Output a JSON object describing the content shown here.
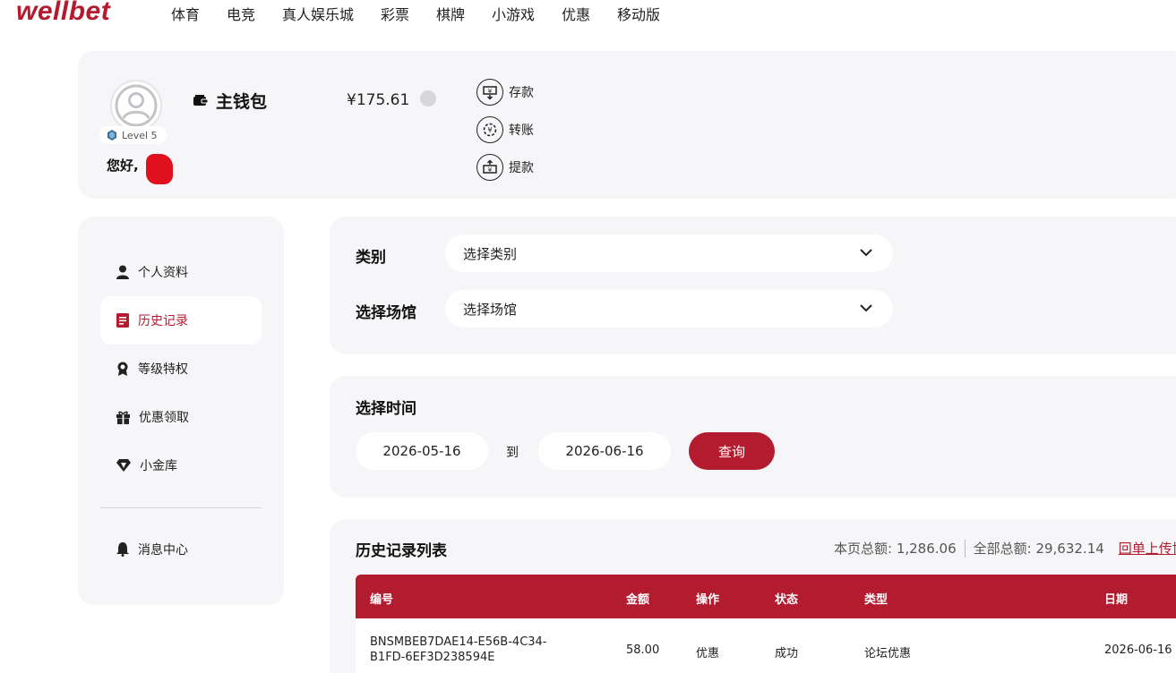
{
  "brand": {
    "logo": "wellbet",
    "accent": "#b31b2f"
  },
  "nav": {
    "items": [
      "体育",
      "电竞",
      "真人娱乐城",
      "彩票",
      "棋牌",
      "小游戏",
      "优惠",
      "移动版"
    ]
  },
  "profile": {
    "level": "Level 5",
    "greeting": "您好,"
  },
  "wallet": {
    "title": "主钱包",
    "balance": "¥175.61",
    "actions": [
      {
        "label": "存款",
        "icon": "deposit-icon"
      },
      {
        "label": "转账",
        "icon": "transfer-icon"
      },
      {
        "label": "提款",
        "icon": "withdraw-icon"
      }
    ]
  },
  "sidebar": {
    "items": [
      {
        "label": "个人资料",
        "icon": "user-icon"
      },
      {
        "label": "历史记录",
        "icon": "history-icon",
        "active": true
      },
      {
        "label": "等级特权",
        "icon": "badge-icon"
      },
      {
        "label": "优惠领取",
        "icon": "gift-icon"
      },
      {
        "label": "小金库",
        "icon": "diamond-icon"
      },
      {
        "label": "消息中心",
        "icon": "bell-icon"
      }
    ]
  },
  "filters": {
    "category_label": "类别",
    "category_value": "选择类别",
    "venue_label": "选择场馆",
    "venue_value": "选择场馆"
  },
  "time": {
    "title": "选择时间",
    "start": "2026-05-16",
    "to": "到",
    "end": "2026-06-16",
    "query": "查询"
  },
  "history": {
    "title": "历史记录列表",
    "page_total": "本页总额: 1,286.06",
    "all_total": "全部总额: 29,632.14",
    "link": "回单上传协",
    "columns": [
      "编号",
      "金额",
      "操作",
      "状态",
      "类型",
      "日期"
    ],
    "rows": [
      {
        "id_line1": "BNSMBEB7DAE14-E56B-4C34-",
        "id_line2": "B1FD-6EF3D238594E",
        "amount": "58.00",
        "operation": "优惠",
        "status": "成功",
        "type": "论坛优惠",
        "date": "2026-06-16"
      }
    ]
  }
}
